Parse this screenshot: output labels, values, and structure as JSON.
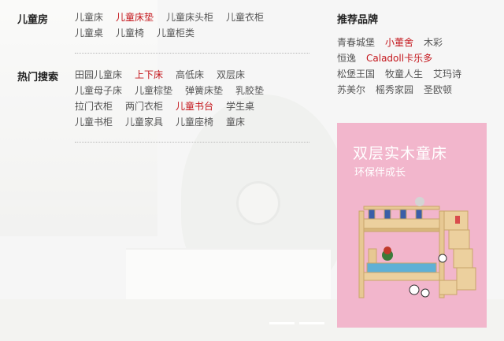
{
  "kids_room": {
    "heading": "儿童房",
    "rows": [
      [
        {
          "label": "儿童床"
        },
        {
          "label": "儿童床垫",
          "highlight": true
        },
        {
          "label": "儿童床头柜"
        },
        {
          "label": "儿童衣柜"
        }
      ],
      [
        {
          "label": "儿童桌"
        },
        {
          "label": "儿童椅"
        },
        {
          "label": "儿童柜类"
        }
      ]
    ]
  },
  "hot_search": {
    "heading": "热门搜索",
    "rows": [
      [
        {
          "label": "田园儿童床"
        },
        {
          "label": "上下床",
          "highlight": true
        },
        {
          "label": "高低床"
        },
        {
          "label": "双层床"
        }
      ],
      [
        {
          "label": "儿童母子床"
        },
        {
          "label": "儿童棕垫"
        },
        {
          "label": "弹簧床垫"
        },
        {
          "label": "乳胶垫"
        }
      ],
      [
        {
          "label": "拉门衣柜"
        },
        {
          "label": "两门衣柜"
        },
        {
          "label": "儿童书台",
          "highlight": true
        },
        {
          "label": "学生桌"
        }
      ],
      [
        {
          "label": "儿童书柜"
        },
        {
          "label": "儿童家具"
        },
        {
          "label": "儿童座椅"
        },
        {
          "label": "童床"
        }
      ]
    ]
  },
  "brands": {
    "heading": "推荐品牌",
    "rows": [
      [
        {
          "label": "青春城堡"
        },
        {
          "label": "小董舍",
          "highlight": true
        },
        {
          "label": "木彩"
        }
      ],
      [
        {
          "label": "恒逸"
        },
        {
          "label": "Caladoll卡乐多",
          "highlight": true
        }
      ],
      [
        {
          "label": "松堡王国"
        },
        {
          "label": "牧童人生"
        },
        {
          "label": "艾玛诗"
        }
      ],
      [
        {
          "label": "苏美尔"
        },
        {
          "label": "榣秀家园"
        },
        {
          "label": "圣欧顿"
        }
      ]
    ]
  },
  "promo": {
    "title": "双层实木童床",
    "subtitle": "环保伴成长"
  },
  "colors": {
    "highlight": "#c4161c",
    "promo_bg": "#f2b6cc"
  }
}
